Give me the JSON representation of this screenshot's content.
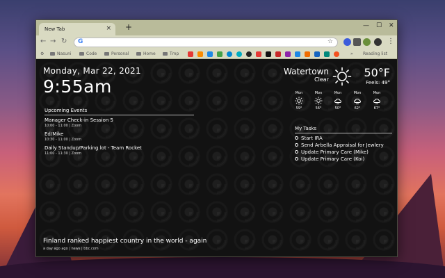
{
  "browser": {
    "tab_title": "New Tab",
    "tab_close": "×",
    "new_tab": "+",
    "win_minimize": "—",
    "win_maximize": "☐",
    "win_close": "✕",
    "omnibox_placeholder": "",
    "bookmarks": [
      "Nasuni",
      "Code",
      "Personal",
      "Home",
      "Tmp"
    ],
    "reading_list": "Reading list"
  },
  "clock": {
    "date": "Monday, Mar 22, 2021",
    "time": "9:55am"
  },
  "events": {
    "title": "Upcoming Events",
    "items": [
      {
        "title": "Manager Check-in Session 5",
        "sub": "10:00 - 11:00 | Zoom"
      },
      {
        "title": "Ed/Mike",
        "sub": "10:30 - 11:00 | Zoom"
      },
      {
        "title": "Daily Standup/Parking lot - Team Rocket",
        "sub": "11:00 - 11:30 | Zoom"
      }
    ]
  },
  "weather": {
    "city": "Watertown",
    "condition": "Clear",
    "temp": "50°F",
    "feels": "Feels: 49°",
    "forecast": [
      {
        "day": "Mon",
        "temp": "59°",
        "icon": "sun-icon"
      },
      {
        "day": "Mon",
        "temp": "56°",
        "icon": "sun-icon"
      },
      {
        "day": "Mon",
        "temp": "50°",
        "icon": "partly-cloudy-icon"
      },
      {
        "day": "Mon",
        "temp": "62°",
        "icon": "partly-cloudy-icon"
      },
      {
        "day": "Mon",
        "temp": "67°",
        "icon": "partly-cloudy-icon"
      }
    ]
  },
  "tasks": {
    "title": "My Tasks",
    "items": [
      "Start IRA",
      "Send Arbella Appraisal for Jewlery",
      "Update Primary Care (Mike)",
      "Update Primary Care (Koi)"
    ]
  },
  "news": {
    "headline": "Finland ranked happiest country in the world - again",
    "meta": "a day ago ago | news | bbc.com"
  },
  "colors": {
    "page_bg": "#121212",
    "chrome_frame": "#b9bb9a",
    "chrome_toolbar": "#d9dac2"
  }
}
